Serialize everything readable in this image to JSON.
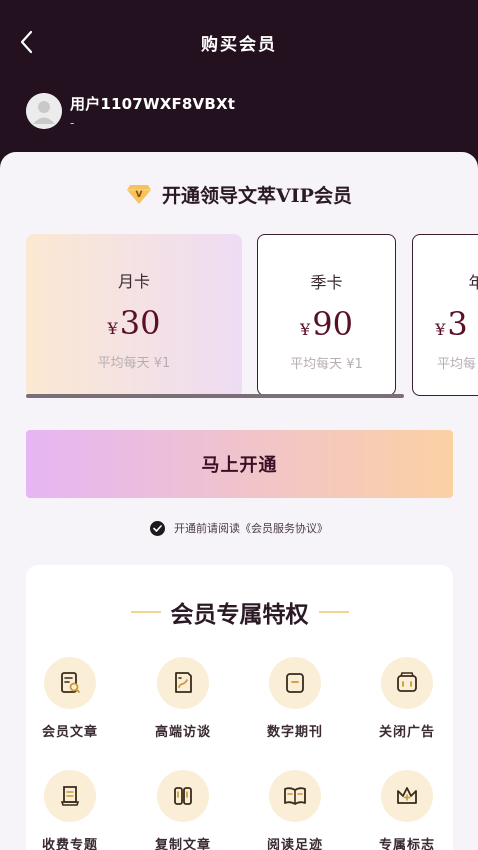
{
  "header": {
    "title": "购买会员",
    "back_icon": "chevron-left-icon"
  },
  "user": {
    "name": "用户1107WXF8VBXt",
    "subtitle": "-"
  },
  "vip_title": "开通领导文萃VIP会员",
  "plans": [
    {
      "name": "月卡",
      "currency": "¥",
      "price": "30",
      "avg": "平均每天 ¥1",
      "selected": true
    },
    {
      "name": "季卡",
      "currency": "¥",
      "price": "90",
      "avg": "平均每天 ¥1",
      "selected": false
    },
    {
      "name": "年",
      "currency": "¥",
      "price": "3",
      "avg": "平均每",
      "selected": false
    }
  ],
  "cta_label": "马上开通",
  "agreement": "开通前请阅读《会员服务协议》",
  "perks_title": "会员专属特权",
  "perks": [
    {
      "label": "会员文章",
      "icon": "article-search-icon"
    },
    {
      "label": "高端访谈",
      "icon": "interview-icon"
    },
    {
      "label": "数字期刊",
      "icon": "magazine-icon"
    },
    {
      "label": "关闭广告",
      "icon": "ad-close-icon"
    },
    {
      "label": "收费专题",
      "icon": "scroll-icon"
    },
    {
      "label": "复制文章",
      "icon": "copy-icon"
    },
    {
      "label": "阅读足迹",
      "icon": "open-book-icon"
    },
    {
      "label": "专属标志",
      "icon": "crown-icon"
    }
  ],
  "colors": {
    "header_bg": "#24111f",
    "accent_gold": "#f3d58f",
    "price": "#5a0f25"
  }
}
